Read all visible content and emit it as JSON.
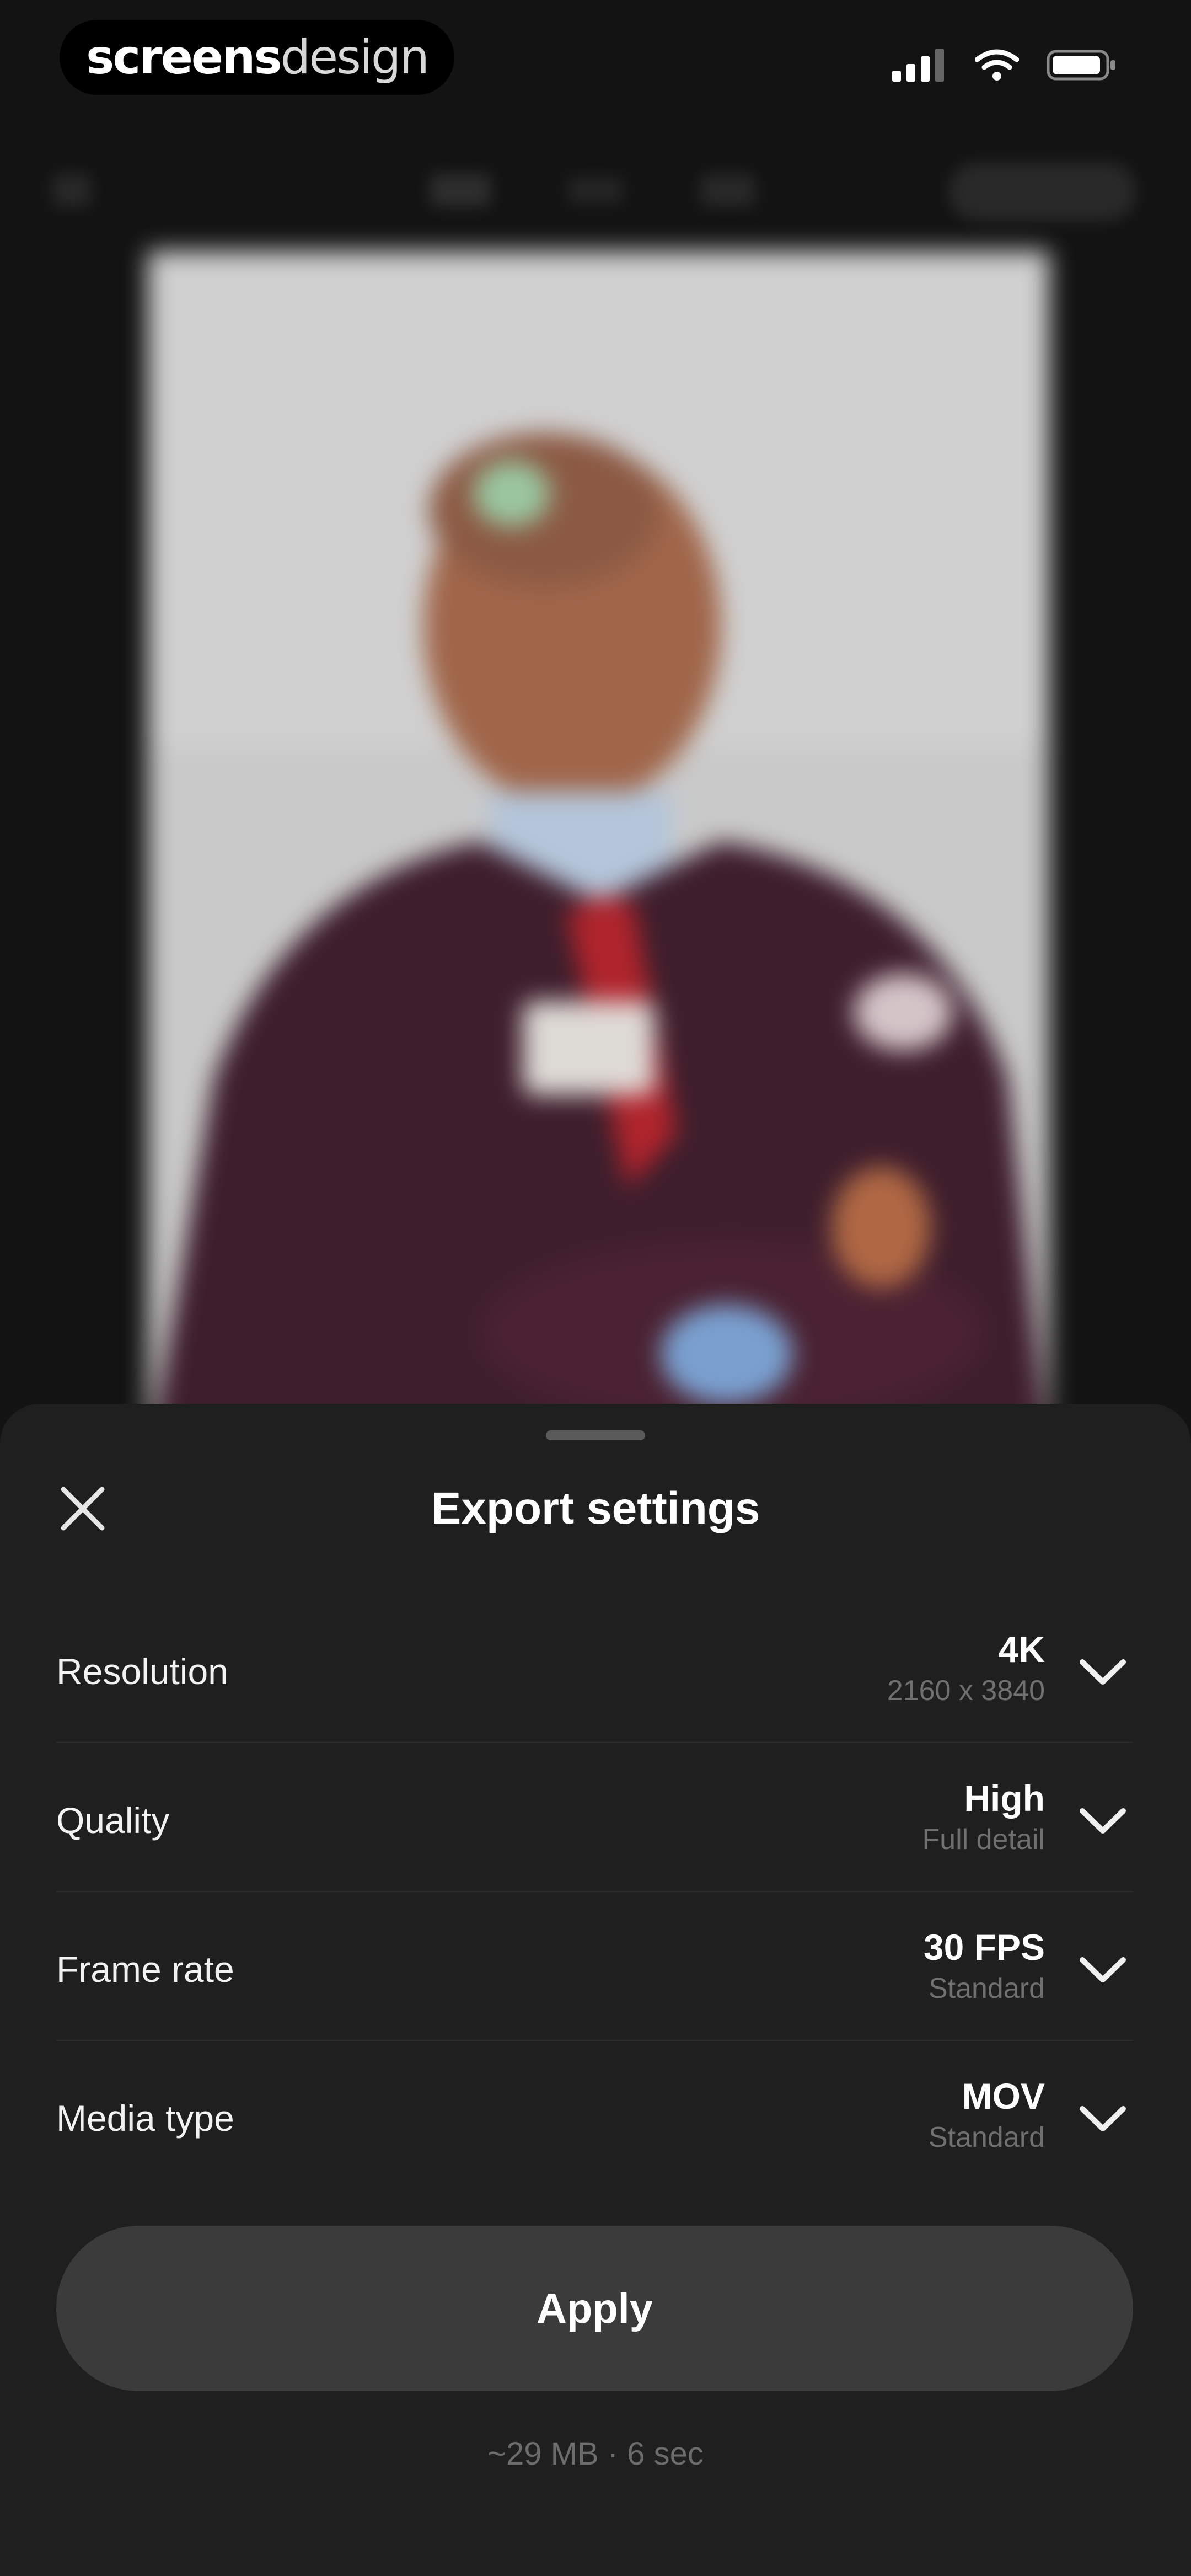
{
  "brand": {
    "bold": "screens",
    "light": "design"
  },
  "status_bar": {
    "icons": [
      "cellular-signal-icon",
      "wifi-icon",
      "battery-icon"
    ]
  },
  "export_sheet": {
    "title": "Export settings",
    "settings": [
      {
        "label": "Resolution",
        "value": "4K",
        "subvalue": "2160 x 3840"
      },
      {
        "label": "Quality",
        "value": "High",
        "subvalue": "Full detail"
      },
      {
        "label": "Frame rate",
        "value": "30 FPS",
        "subvalue": "Standard"
      },
      {
        "label": "Media type",
        "value": "MOV",
        "subvalue": "Standard"
      }
    ],
    "apply_label": "Apply",
    "estimate": "~29 MB · 6 sec"
  },
  "colors": {
    "background": "#131313",
    "sheet": "#1f1f1f",
    "apply_button": "#3b3b3b",
    "secondary_text": "#707070"
  }
}
